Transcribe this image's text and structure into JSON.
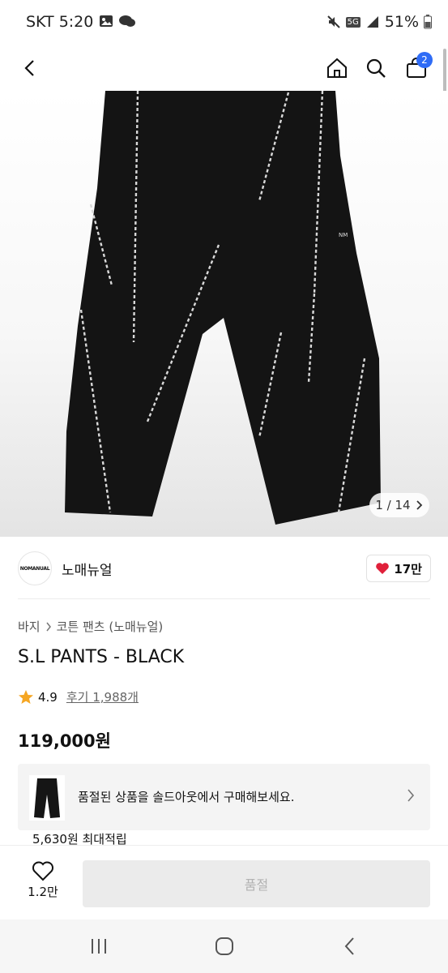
{
  "status": {
    "time": "SKT 5:20",
    "network": "5G",
    "battery": "51%"
  },
  "nav": {
    "cart_count": "2"
  },
  "gallery": {
    "counter": "1 / 14",
    "garment_mark": "NM"
  },
  "brand": {
    "logo_text": "NOMANUAL",
    "name": "노매뉴얼",
    "likes": "17만"
  },
  "breadcrumb": {
    "category": "바지",
    "subcategory": "코튼 팬츠 (노매뉴얼)"
  },
  "product": {
    "title": "S.L PANTS - BLACK",
    "rating": "4.9",
    "reviews": "후기 1,988개",
    "price": "119,000원"
  },
  "promo": {
    "text": "품절된 상품을 솔드아웃에서 구매해보세요."
  },
  "points": {
    "text": "5,630원 최대적립"
  },
  "bottom": {
    "wish_count": "1.2만",
    "action_label": "품절"
  },
  "colors": {
    "badge": "#2f6cf6",
    "heart": "#e0203a",
    "star": "#f5a623"
  },
  "icons": [
    "back-arrow-icon",
    "home-icon",
    "search-icon",
    "cart-icon",
    "heart-icon",
    "star-icon",
    "chevron-right-icon"
  ]
}
